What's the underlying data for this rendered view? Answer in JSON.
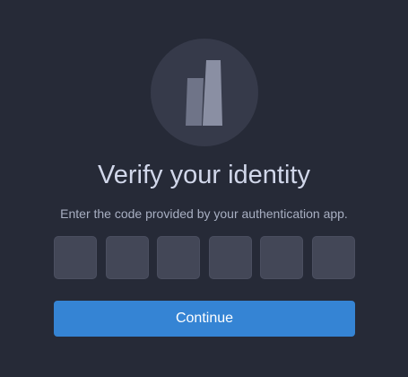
{
  "logo": {
    "icon": "document-stack-icon"
  },
  "heading": {
    "title": "Verify your identity",
    "subtitle": "Enter the code provided by your authentication app."
  },
  "code_inputs": {
    "count": 6,
    "values": [
      "",
      "",
      "",
      "",
      "",
      ""
    ]
  },
  "actions": {
    "continue_label": "Continue"
  },
  "colors": {
    "background": "#262a37",
    "logo_circle": "#363a4a",
    "input_background": "#434757",
    "accent": "#3584d4",
    "title_text": "#d1d7ea",
    "subtitle_text": "#a8afc2"
  }
}
